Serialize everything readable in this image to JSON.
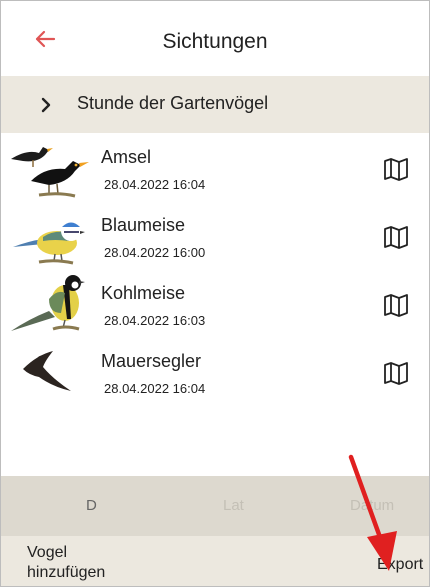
{
  "header": {
    "title": "Sichtungen",
    "back_icon": "arrow-left-icon",
    "accent_color": "#e05555"
  },
  "group": {
    "label": "Stunde der Gartenvögel",
    "icon": "chevron-right-icon",
    "background": "#ece8df"
  },
  "sightings": [
    {
      "name": "Amsel",
      "datetime": "28.04.2022 16:04",
      "image": "amsel-bird-icon",
      "action_icon": "map-icon"
    },
    {
      "name": "Blaumeise",
      "datetime": "28.04.2022 16:00",
      "image": "blaumeise-bird-icon",
      "action_icon": "map-icon"
    },
    {
      "name": "Kohlmeise",
      "datetime": "28.04.2022 16:03",
      "image": "kohlmeise-bird-icon",
      "action_icon": "map-icon"
    },
    {
      "name": "Mauersegler",
      "datetime": "28.04.2022 16:04",
      "image": "mauersegler-bird-icon",
      "action_icon": "map-icon"
    }
  ],
  "sort_tabs": [
    {
      "label": "D",
      "active": true
    },
    {
      "label": "Lat",
      "active": false
    },
    {
      "label": "Datum",
      "active": false
    }
  ],
  "footer": {
    "add_label": "Vogel hinzufügen",
    "export_label": "Export"
  },
  "annotation": {
    "icon": "red-arrow-icon",
    "color": "#e02020"
  }
}
